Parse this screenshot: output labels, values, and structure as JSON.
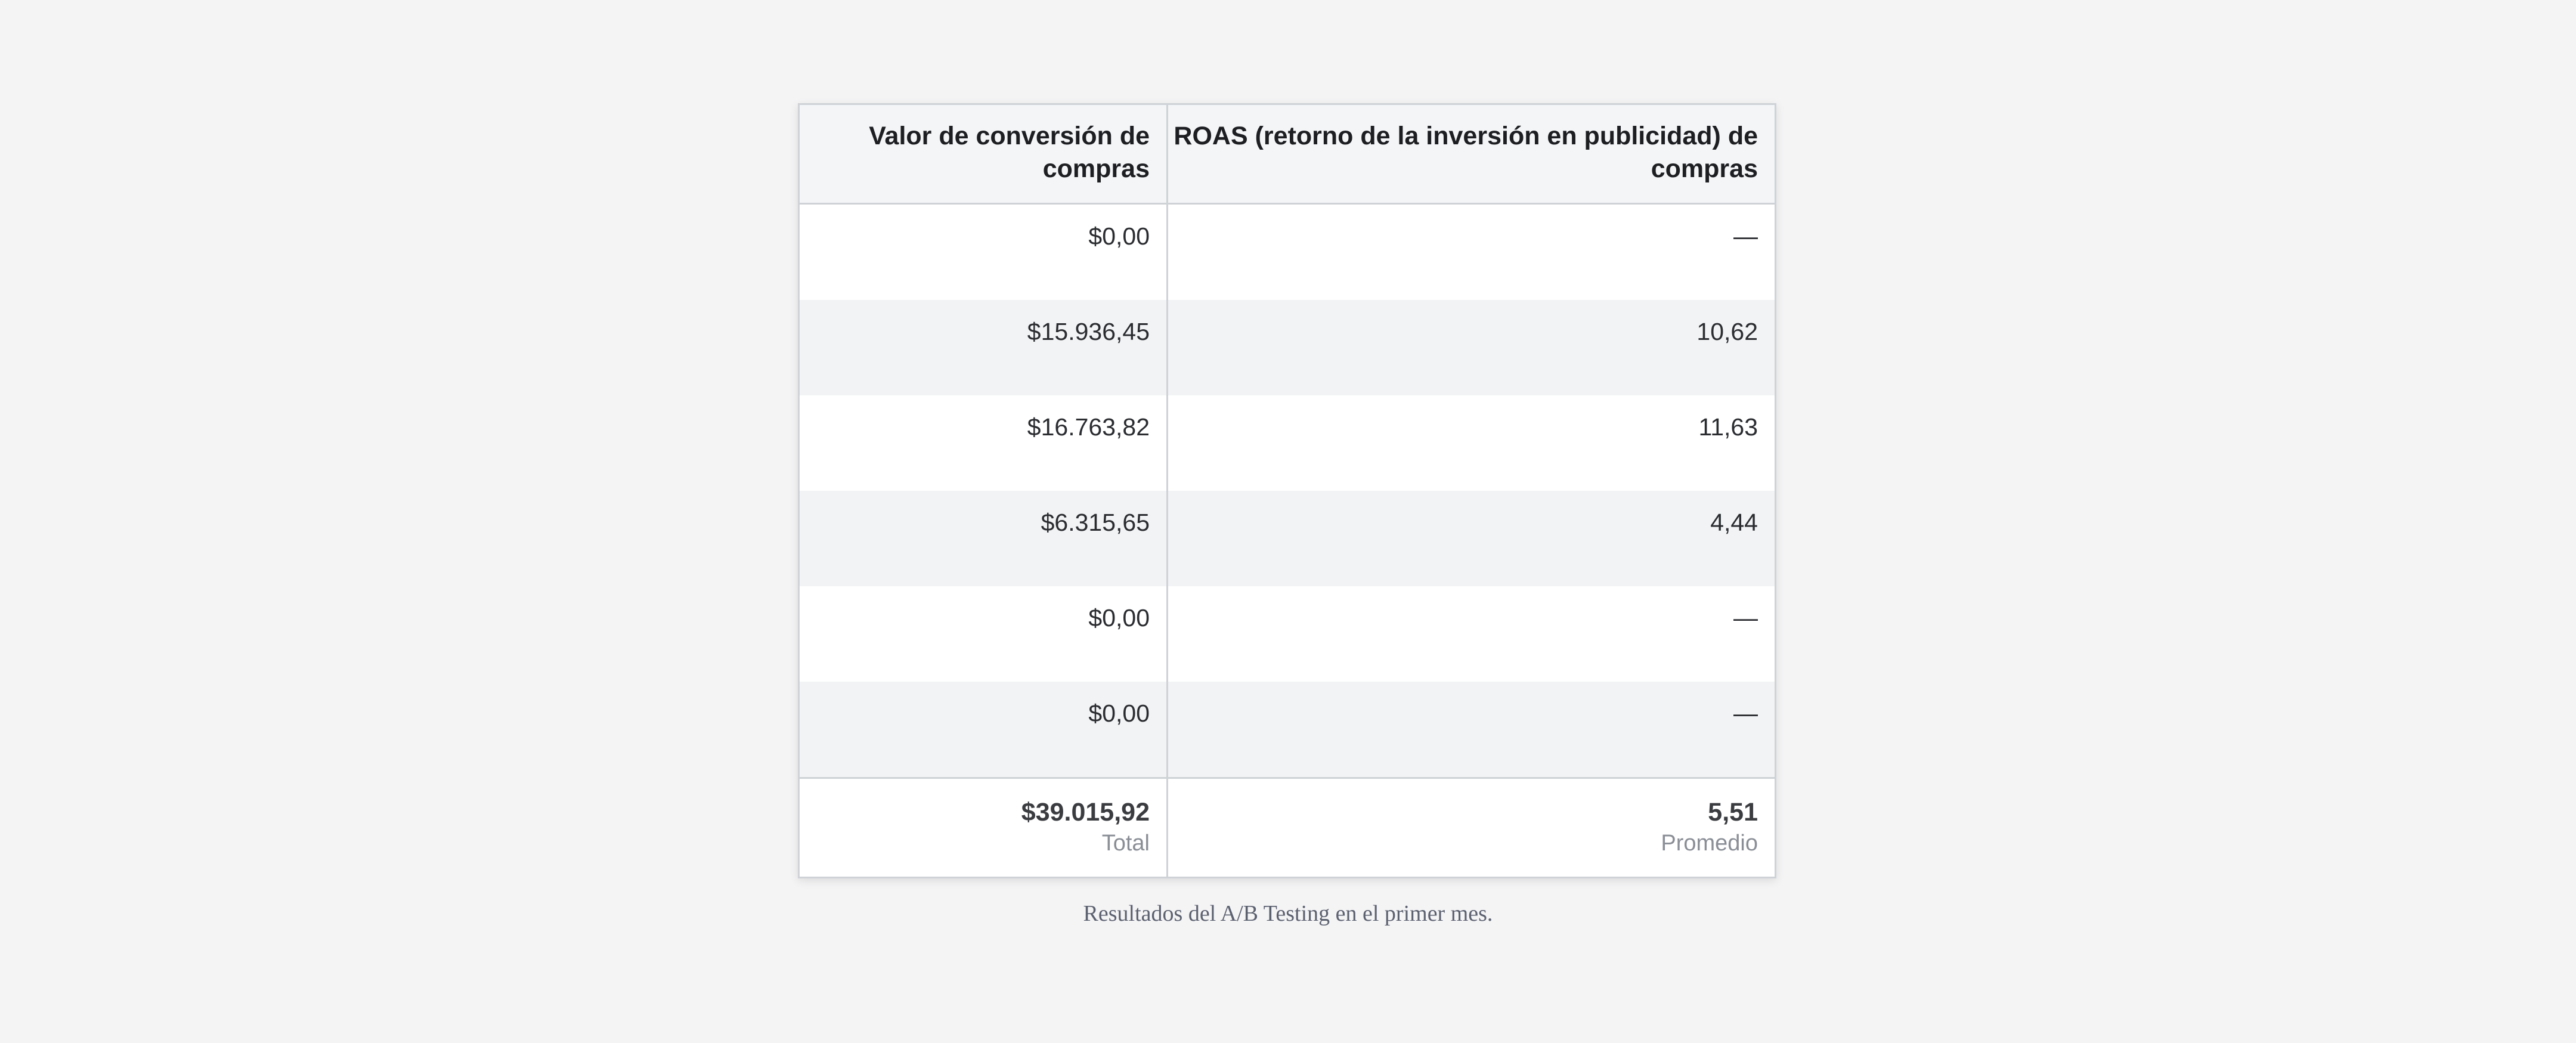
{
  "table": {
    "headers": [
      "Valor de conversión de compras",
      "ROAS (retorno de la inversión en publicidad) de compras"
    ],
    "rows": [
      {
        "value": "$0,00",
        "roas": "—"
      },
      {
        "value": "$15.936,45",
        "roas": "10,62"
      },
      {
        "value": "$16.763,82",
        "roas": "11,63"
      },
      {
        "value": "$6.315,65",
        "roas": "4,44"
      },
      {
        "value": "$0,00",
        "roas": "—"
      },
      {
        "value": "$0,00",
        "roas": "—"
      }
    ],
    "totals": {
      "value": "$39.015,92",
      "value_label": "Total",
      "roas": "5,51",
      "roas_label": "Promedio"
    }
  },
  "caption": "Resultados del A/B Testing en el primer mes."
}
